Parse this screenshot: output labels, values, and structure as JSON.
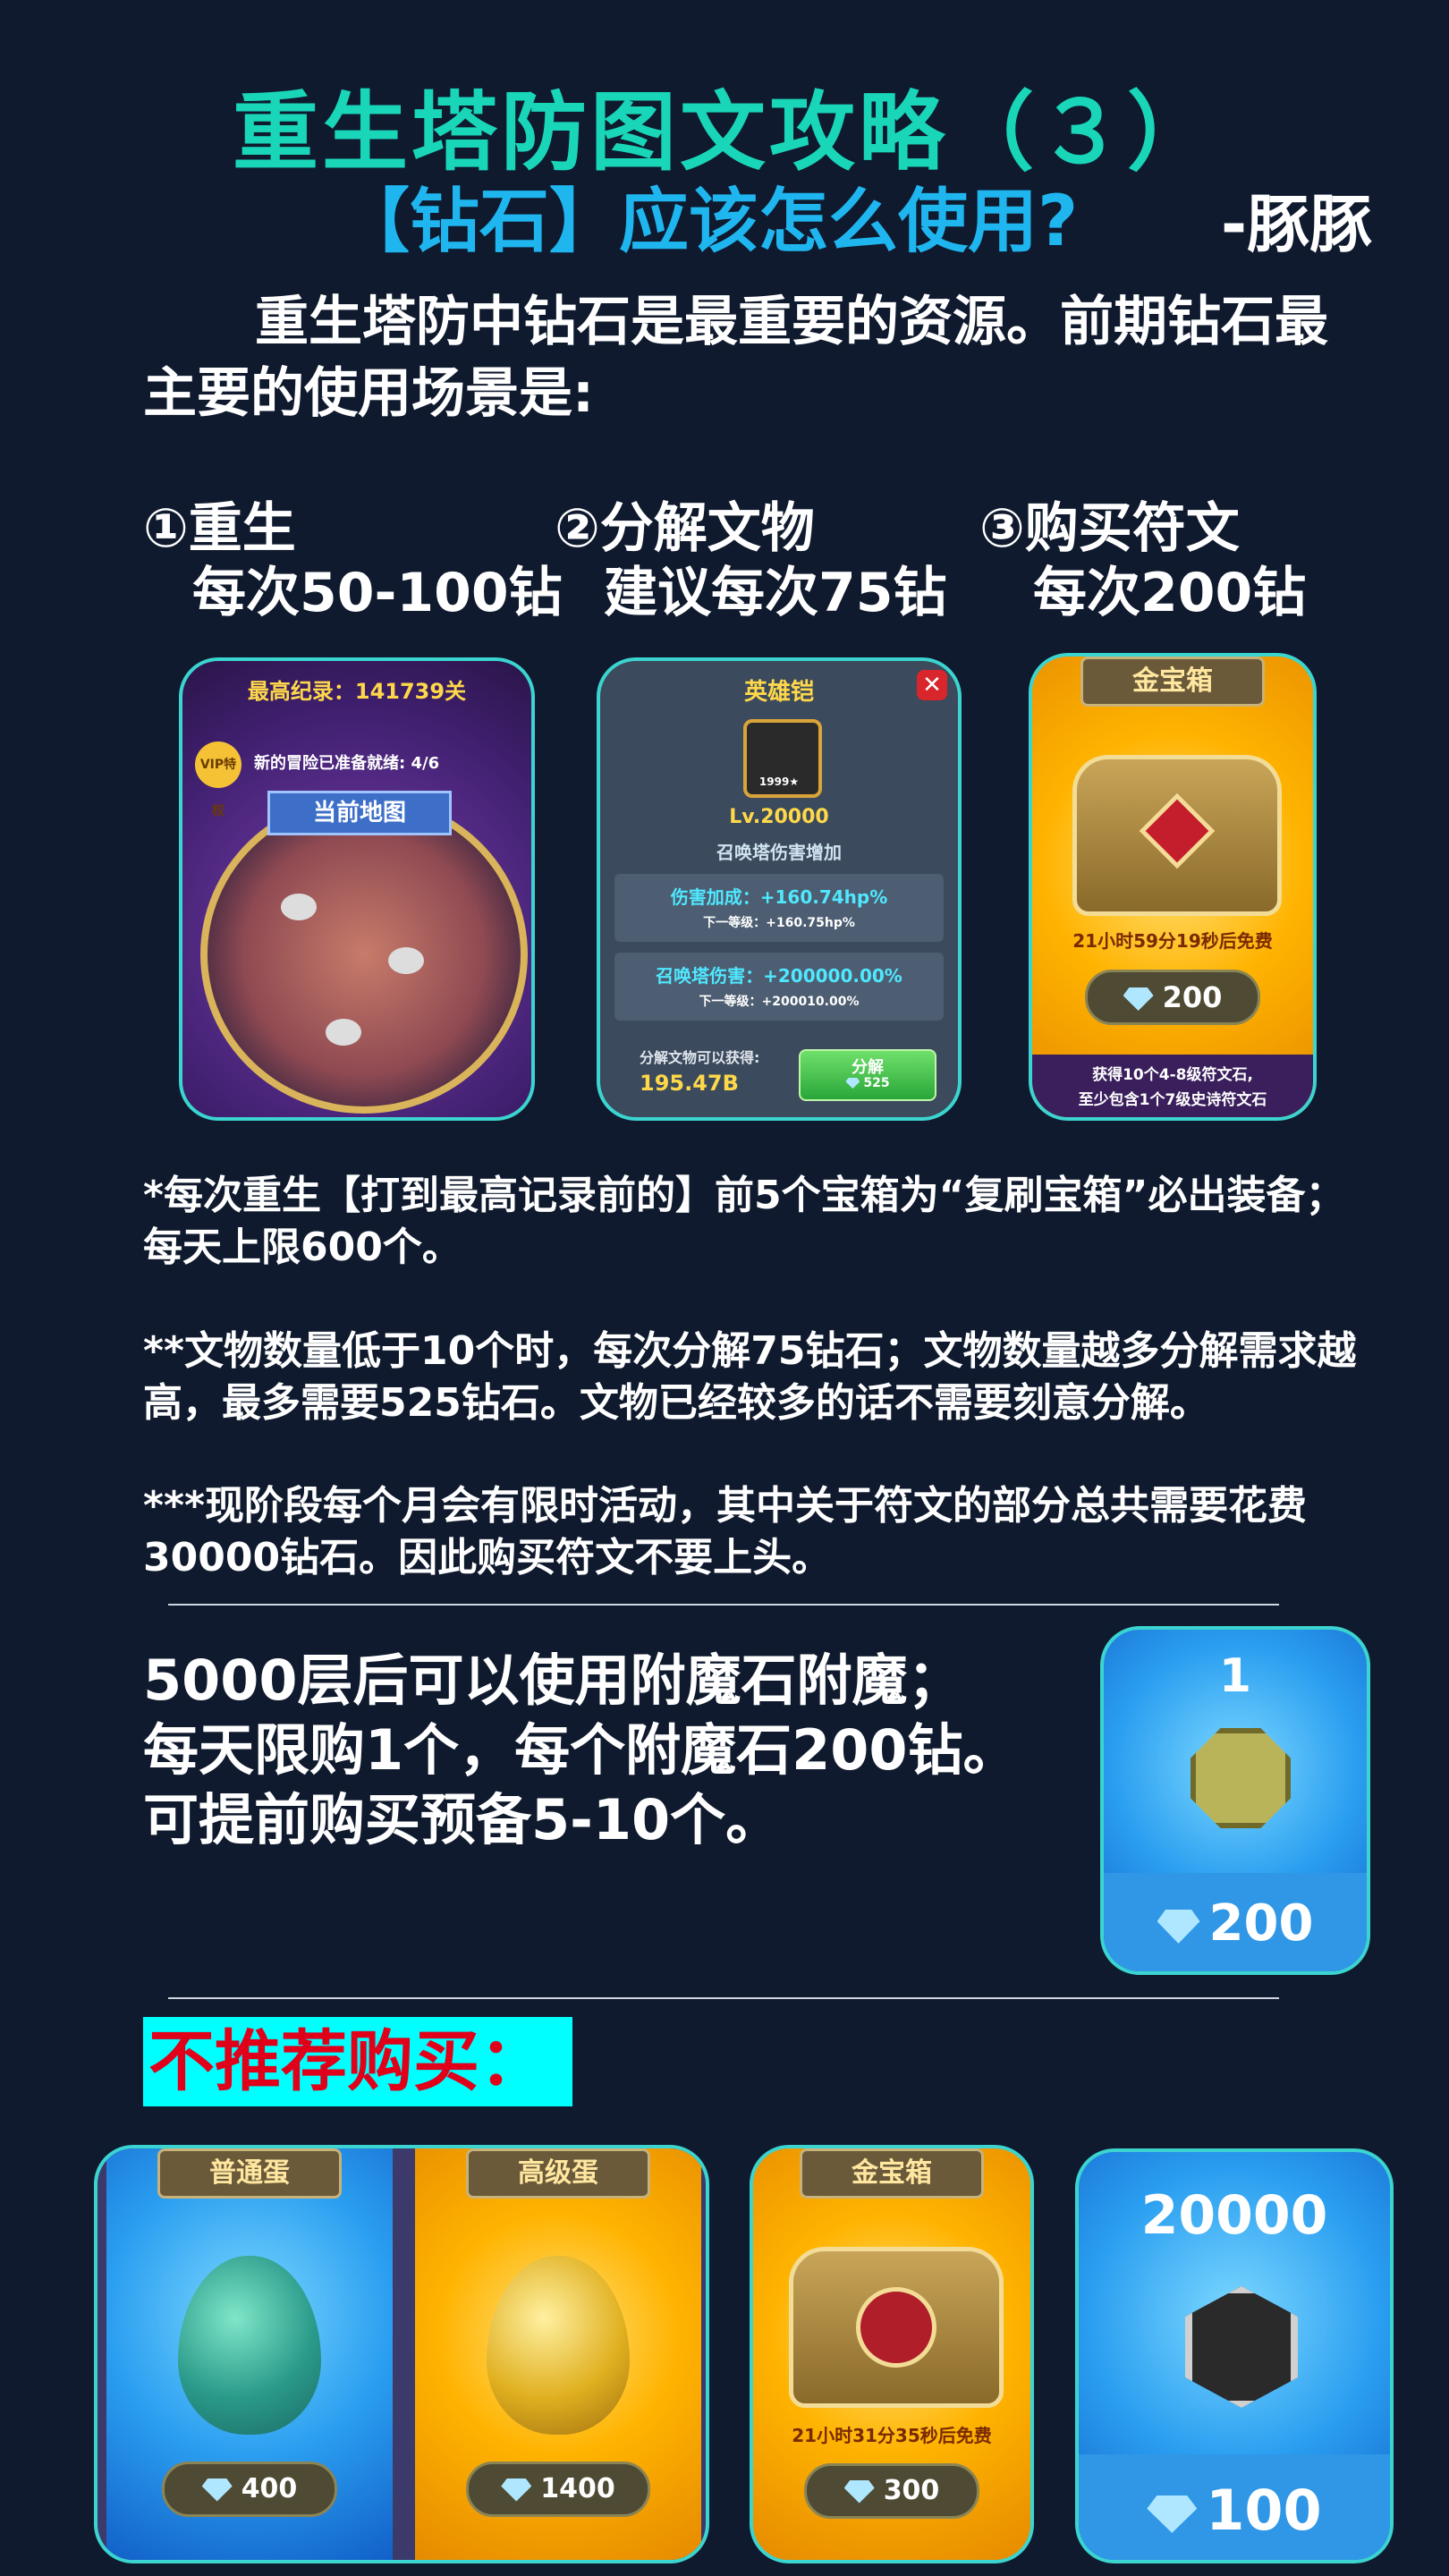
{
  "header": {
    "title": "重生塔防图文攻略（３）",
    "subtitle": "【钻石】应该怎么使用?",
    "author": "-豚豚"
  },
  "intro": "重生塔防中钻石是最重要的资源。前期钻石最主要的使用场景是:",
  "uses": [
    {
      "name": "①重生",
      "cost": "每次50-100钻"
    },
    {
      "name": "②分解文物",
      "cost": "建议每次75钻"
    },
    {
      "name": "③购买符文",
      "cost": "每次200钻"
    }
  ],
  "card_rebirth": {
    "record": "最高纪录：141739关",
    "vip": "VIP特权",
    "ready": "新的冒险已准备就绪: 4/6",
    "map": "当前地图"
  },
  "card_relic": {
    "title": "英雄铠",
    "badge": "1999★",
    "level": "Lv.20000",
    "desc": "召唤塔伤害增加",
    "stat1": "伤害加成：+160.74hp%",
    "stat1_next": "下一等级：+160.75hp%",
    "stat2": "召唤塔伤害：+200000.00%",
    "stat2_next": "下一等级：+200010.00%",
    "gain_label": "分解文物可以获得:",
    "gain_value": "195.47B",
    "button": "分解",
    "button_cost": "525"
  },
  "card_rune": {
    "title": "金宝箱",
    "timer": "21小时59分19秒后免费",
    "price": "200",
    "foot1": "获得10个4-8级符文石,",
    "foot2": "至少包含1个7级史诗符文石"
  },
  "notes": [
    "*每次重生【打到最高记录前的】前5个宝箱为“复刷宝箱”必出装备；每天上限600个。",
    "**文物数量低于10个时，每次分解75钻石；文物数量越多分解需求越高，最多需要525钻石。文物已经较多的话不需要刻意分解。",
    "***现阶段每个月会有限时活动，其中关于符文的部分总共需要花费30000钻石。因此购买符文不要上头。"
  ],
  "enchant": {
    "lines": [
      "5000层后可以使用附魔石附魔；",
      "每天限购1个，每个附魔石200钻。",
      "可提前购买预备5-10个。"
    ],
    "card_count": "1",
    "card_price": "200"
  },
  "not_recommended": {
    "label": "不推荐购买：",
    "items": [
      {
        "title": "普通蛋",
        "price": "400"
      },
      {
        "title": "高级蛋",
        "price": "1400"
      },
      {
        "title": "金宝箱",
        "timer": "21小时31分35秒后免费",
        "price": "300"
      },
      {
        "count": "20000",
        "price": "100"
      }
    ]
  },
  "colors": {
    "background": "#0f1a2e",
    "title": "#19d6b9",
    "subtitle": "#1fb6f0",
    "card_border": "#3bd4d0",
    "highlight_bg": "#00ffff",
    "highlight_text": "#e0001a"
  }
}
